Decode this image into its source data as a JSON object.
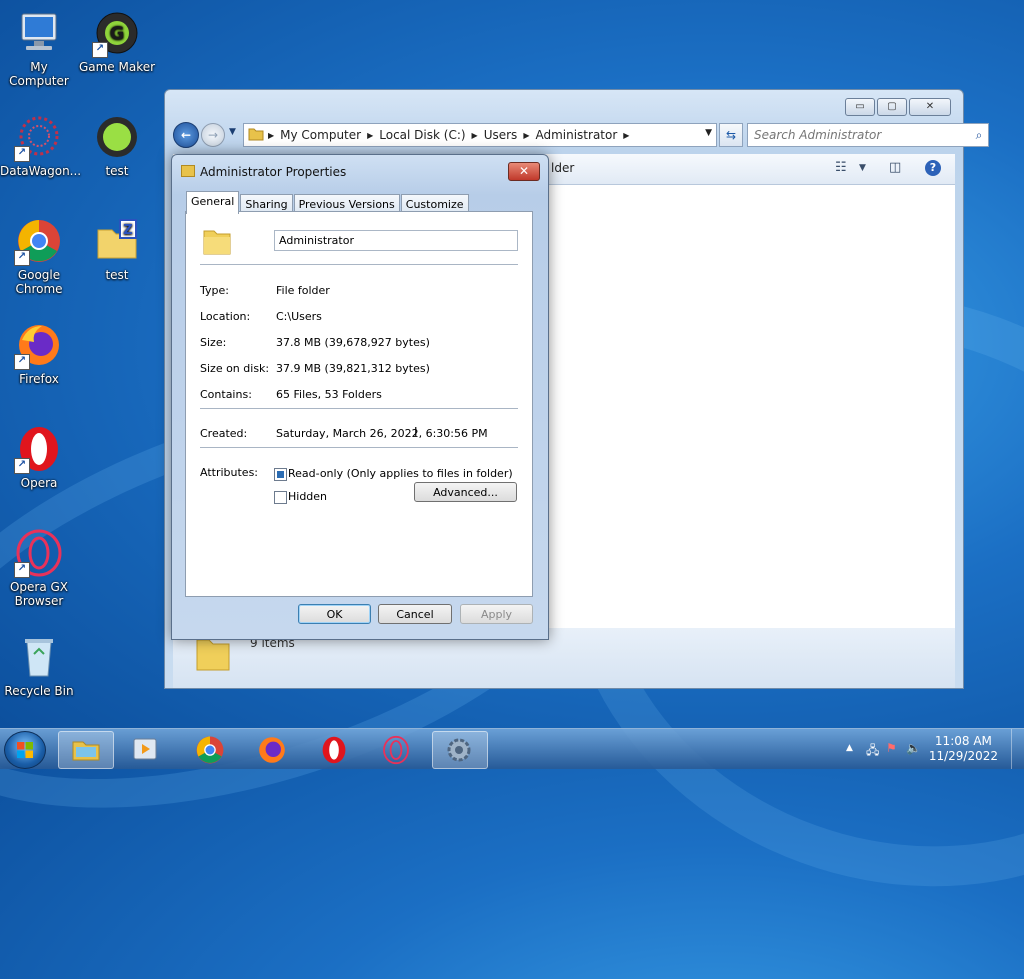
{
  "desktop": {
    "icons": [
      {
        "label": "My Computer"
      },
      {
        "label": "Game Maker"
      },
      {
        "label": "DataWagon..."
      },
      {
        "label": "test"
      },
      {
        "label": "Google Chrome"
      },
      {
        "label": "test"
      },
      {
        "label": "Firefox"
      },
      {
        "label": "Opera"
      },
      {
        "label": "Opera GX Browser"
      },
      {
        "label": "Recycle Bin"
      }
    ]
  },
  "explorer": {
    "breadcrumb": [
      "My Computer",
      "Local Disk (C:)",
      "Users",
      "Administrator"
    ],
    "search_placeholder": "Search Administrator",
    "toolbar_partial_label": "lder",
    "item_count": "9 items",
    "window_buttons": {
      "minimize": "▭",
      "maximize": "▢",
      "close": "✕"
    }
  },
  "dialog": {
    "title": "Administrator Properties",
    "tabs": [
      "General",
      "Sharing",
      "Previous Versions",
      "Customize"
    ],
    "active_tab": "General",
    "folder_name": "Administrator",
    "properties": [
      {
        "label": "Type:",
        "value": "File folder"
      },
      {
        "label": "Location:",
        "value": "C:\\Users"
      },
      {
        "label": "Size:",
        "value": "37.8 MB (39,678,927 bytes)"
      },
      {
        "label": "Size on disk:",
        "value": "37.9 MB (39,821,312 bytes)"
      },
      {
        "label": "Contains:",
        "value": "65 Files, 53 Folders"
      }
    ],
    "created_label": "Created:",
    "created_value": "Saturday, March 26, 2022, 6:30:56 PM",
    "attributes_label": "Attributes:",
    "readonly_label": "Read-only (Only applies to files in folder)",
    "hidden_label": "Hidden",
    "advanced_label": "Advanced...",
    "ok_label": "OK",
    "cancel_label": "Cancel",
    "apply_label": "Apply"
  },
  "taskbar": {
    "clock_time": "11:08 AM",
    "clock_date": "11/29/2022"
  },
  "colors": {
    "accent": "#1d4f9a",
    "close_red": "#c0392b"
  }
}
